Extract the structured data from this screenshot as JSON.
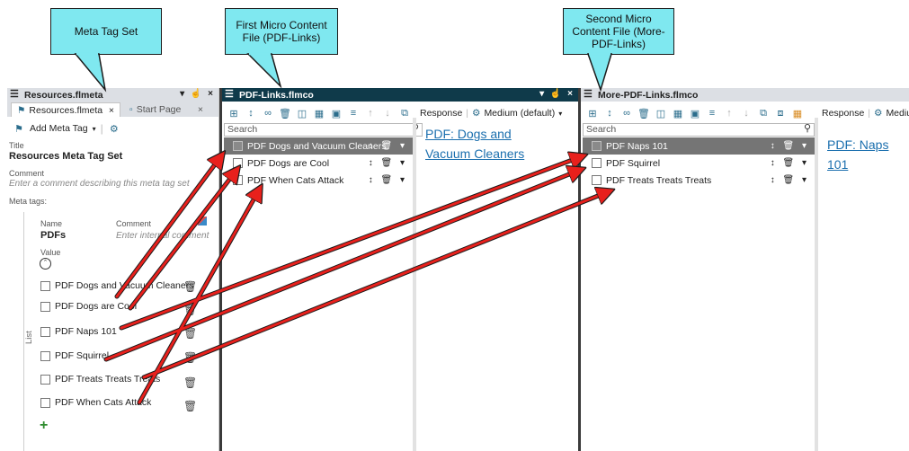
{
  "callouts": {
    "meta": "Meta Tag Set",
    "first": "First Micro Content File (PDF-Links)",
    "second": "Second Micro Content File (More-PDF-Links)"
  },
  "meta_panel": {
    "title": "Resources.flmeta",
    "tab_active": "Resources.flmeta",
    "tab_inactive": "Start Page",
    "add_button": "Add Meta Tag",
    "title_label": "Title",
    "title_value": "Resources Meta Tag Set",
    "comment_label": "Comment",
    "comment_placeholder": "Enter a comment describing this meta tag set",
    "meta_tags_label": "Meta tags:",
    "name_label": "Name",
    "comment_col_label": "Comment",
    "tag_name": "PDFs",
    "tag_comment_placeholder": "Enter internal comment",
    "value_label": "Value",
    "list_label": "List",
    "items": [
      "PDF Dogs and Vacuum Cleaners",
      "PDF Dogs are Cool",
      "PDF Naps 101",
      "PDF Squirrel",
      "PDF Treats Treats Treats",
      "PDF When Cats Attack"
    ]
  },
  "pdf_links_panel": {
    "title": "PDF-Links.flmco",
    "search_placeholder": "Search",
    "rows": [
      "PDF Dogs and Vacuum Cleaners",
      "PDF Dogs are Cool",
      "PDF When Cats Attack"
    ],
    "selected_index": 0,
    "response_label": "Response",
    "medium_label": "Medium (default)",
    "response_link": "PDF: Dogs and Vacuum Cleaners"
  },
  "more_pdf_links_panel": {
    "title": "More-PDF-Links.flmco",
    "search_placeholder": "Search",
    "rows": [
      "PDF Naps 101",
      "PDF Squirrel",
      "PDF Treats Treats Treats"
    ],
    "selected_index": 0,
    "response_label": "Response",
    "medium_label": "Mediun",
    "response_link": "PDF: Naps 101"
  },
  "colors": {
    "callout_fill": "#7fe8f0",
    "arrow": "#e8201c",
    "dark_title": "#0f3a4a",
    "selected_row": "#757575",
    "link": "#1b6fae"
  }
}
